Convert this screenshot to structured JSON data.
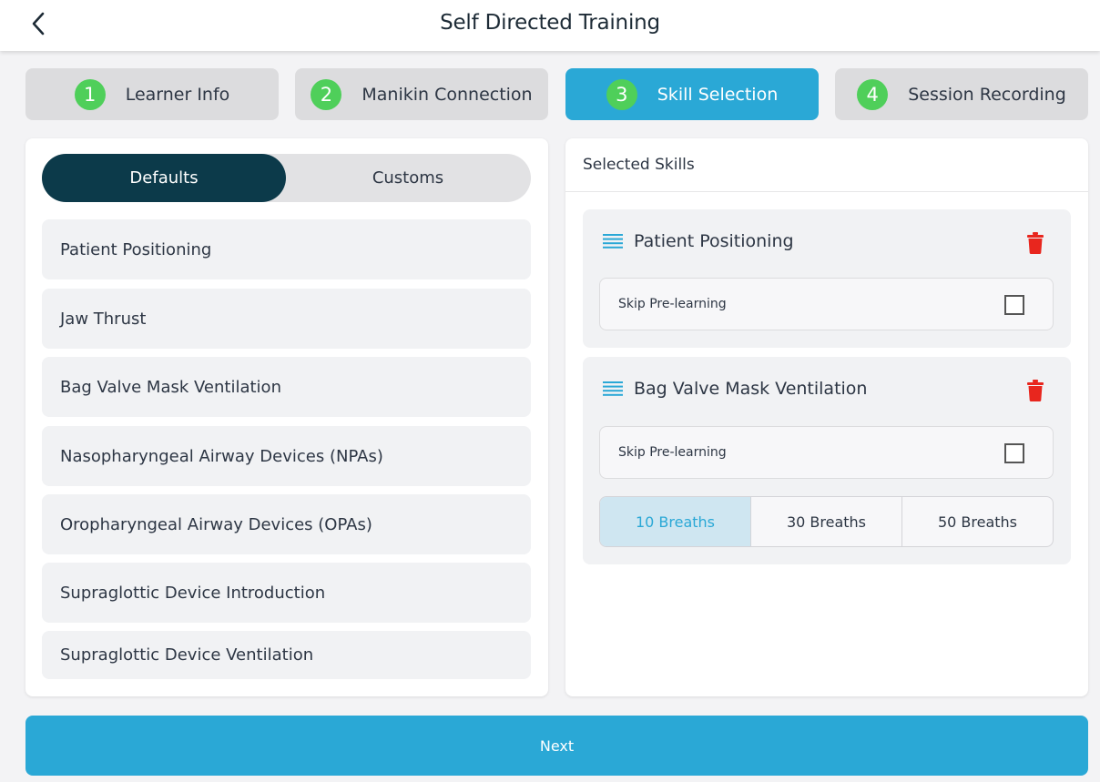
{
  "header": {
    "title": "Self Directed Training"
  },
  "steps": [
    {
      "number": "1",
      "label": "Learner Info"
    },
    {
      "number": "2",
      "label": "Manikin Connection"
    },
    {
      "number": "3",
      "label": "Skill Selection"
    },
    {
      "number": "4",
      "label": "Session Recording"
    }
  ],
  "active_step": "Skill Selection",
  "skill_tabs": {
    "defaults": "Defaults",
    "customs": "Customs",
    "selected": "Defaults"
  },
  "skill_list": [
    "Patient Positioning",
    "Jaw Thrust",
    "Bag Valve Mask Ventilation",
    "Nasopharyngeal Airway Devices (NPAs)",
    "Oropharyngeal Airway Devices (OPAs)",
    "Supraglottic Device Introduction",
    "Supraglottic Device Ventilation"
  ],
  "selected_panel": {
    "title": "Selected Skills",
    "skills": [
      {
        "name": "Patient Positioning",
        "skip_label": "Skip Pre-learning",
        "skip_checked": false
      },
      {
        "name": "Bag Valve Mask Ventilation",
        "skip_label": "Skip Pre-learning",
        "skip_checked": false,
        "breath_options": [
          "10 Breaths",
          "30 Breaths",
          "50 Breaths"
        ],
        "breath_selected": "10 Breaths"
      }
    ]
  },
  "next_button": "Next",
  "colors": {
    "accent": "#2aa8d6",
    "step_badge": "#4fcf5a",
    "toggle_active": "#0c3a4a",
    "trash": "#e8261e"
  },
  "icons": {
    "back": "chevron-left-icon",
    "drag": "drag-handle-icon",
    "delete": "trash-icon"
  }
}
